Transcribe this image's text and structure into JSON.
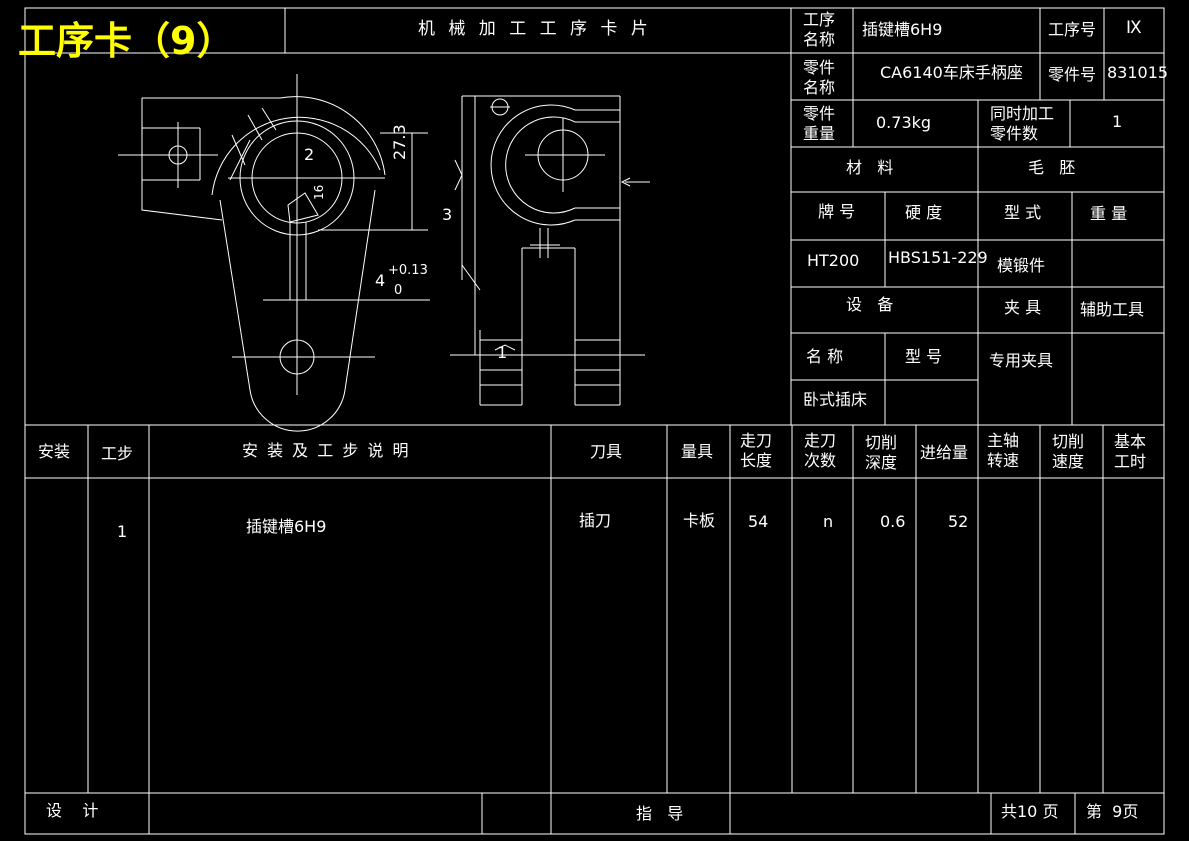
{
  "header": {
    "title": "工序卡（9）",
    "card_name": "机 械 加 工 工 序 卡 片"
  },
  "info": {
    "op_name_label": "工序\n名称",
    "op_name": "插键槽6H9",
    "op_no_label": "工序号",
    "op_no": "Ⅸ",
    "part_name_label": "零件\n名称",
    "part_name": "CA6140车床手柄座",
    "part_no_label": "零件号",
    "part_no": "831015",
    "part_weight_label": "零件\n重量",
    "part_weight": "0.73kg",
    "simul_label": "同时加工\n零件数",
    "simul": "1",
    "material_label": "材   料",
    "blank_label": "毛   胚",
    "grade_label": "牌 号",
    "hardness_label": "硬 度",
    "type_label": "型 式",
    "weight_label": "重 量",
    "grade": "HT200",
    "hardness": "HBS151-229",
    "blank_type": "模锻件",
    "equipment_label": "设   备",
    "fixture_label": "夹 具",
    "aux_tool_label": "辅助工具",
    "eq_name_label": "名 称",
    "eq_model_label": "型 号",
    "fixture": "专用夹具",
    "equipment": "卧式插床"
  },
  "drawing": {
    "label_1": "1",
    "label_2": "2",
    "label_3": "3",
    "dim_273": "27.3",
    "dim_16": "16",
    "dim_4": "4",
    "tol_upper": "+0.13",
    "tol_lower": "0"
  },
  "table": {
    "headers": {
      "install": "安装",
      "step": "工步",
      "desc": "安 装 及 工 步 说 明",
      "tool": "刀具",
      "gauge": "量具",
      "travel_len": "走刀\n长度",
      "passes": "走刀\n次数",
      "depth": "切削\n深度",
      "feed": "进给量",
      "spindle": "主轴\n转速",
      "speed": "切削\n速度",
      "time": "基本\n工时"
    },
    "row": {
      "step": "1",
      "desc": "插键槽6H9",
      "tool": "插刀",
      "gauge": "卡板",
      "travel_len": "54",
      "passes": "n",
      "depth": "0.6",
      "feed": "52"
    }
  },
  "footer": {
    "design": "设    计",
    "guide": "指   导",
    "total": "共10 页",
    "page": "第  9页"
  }
}
